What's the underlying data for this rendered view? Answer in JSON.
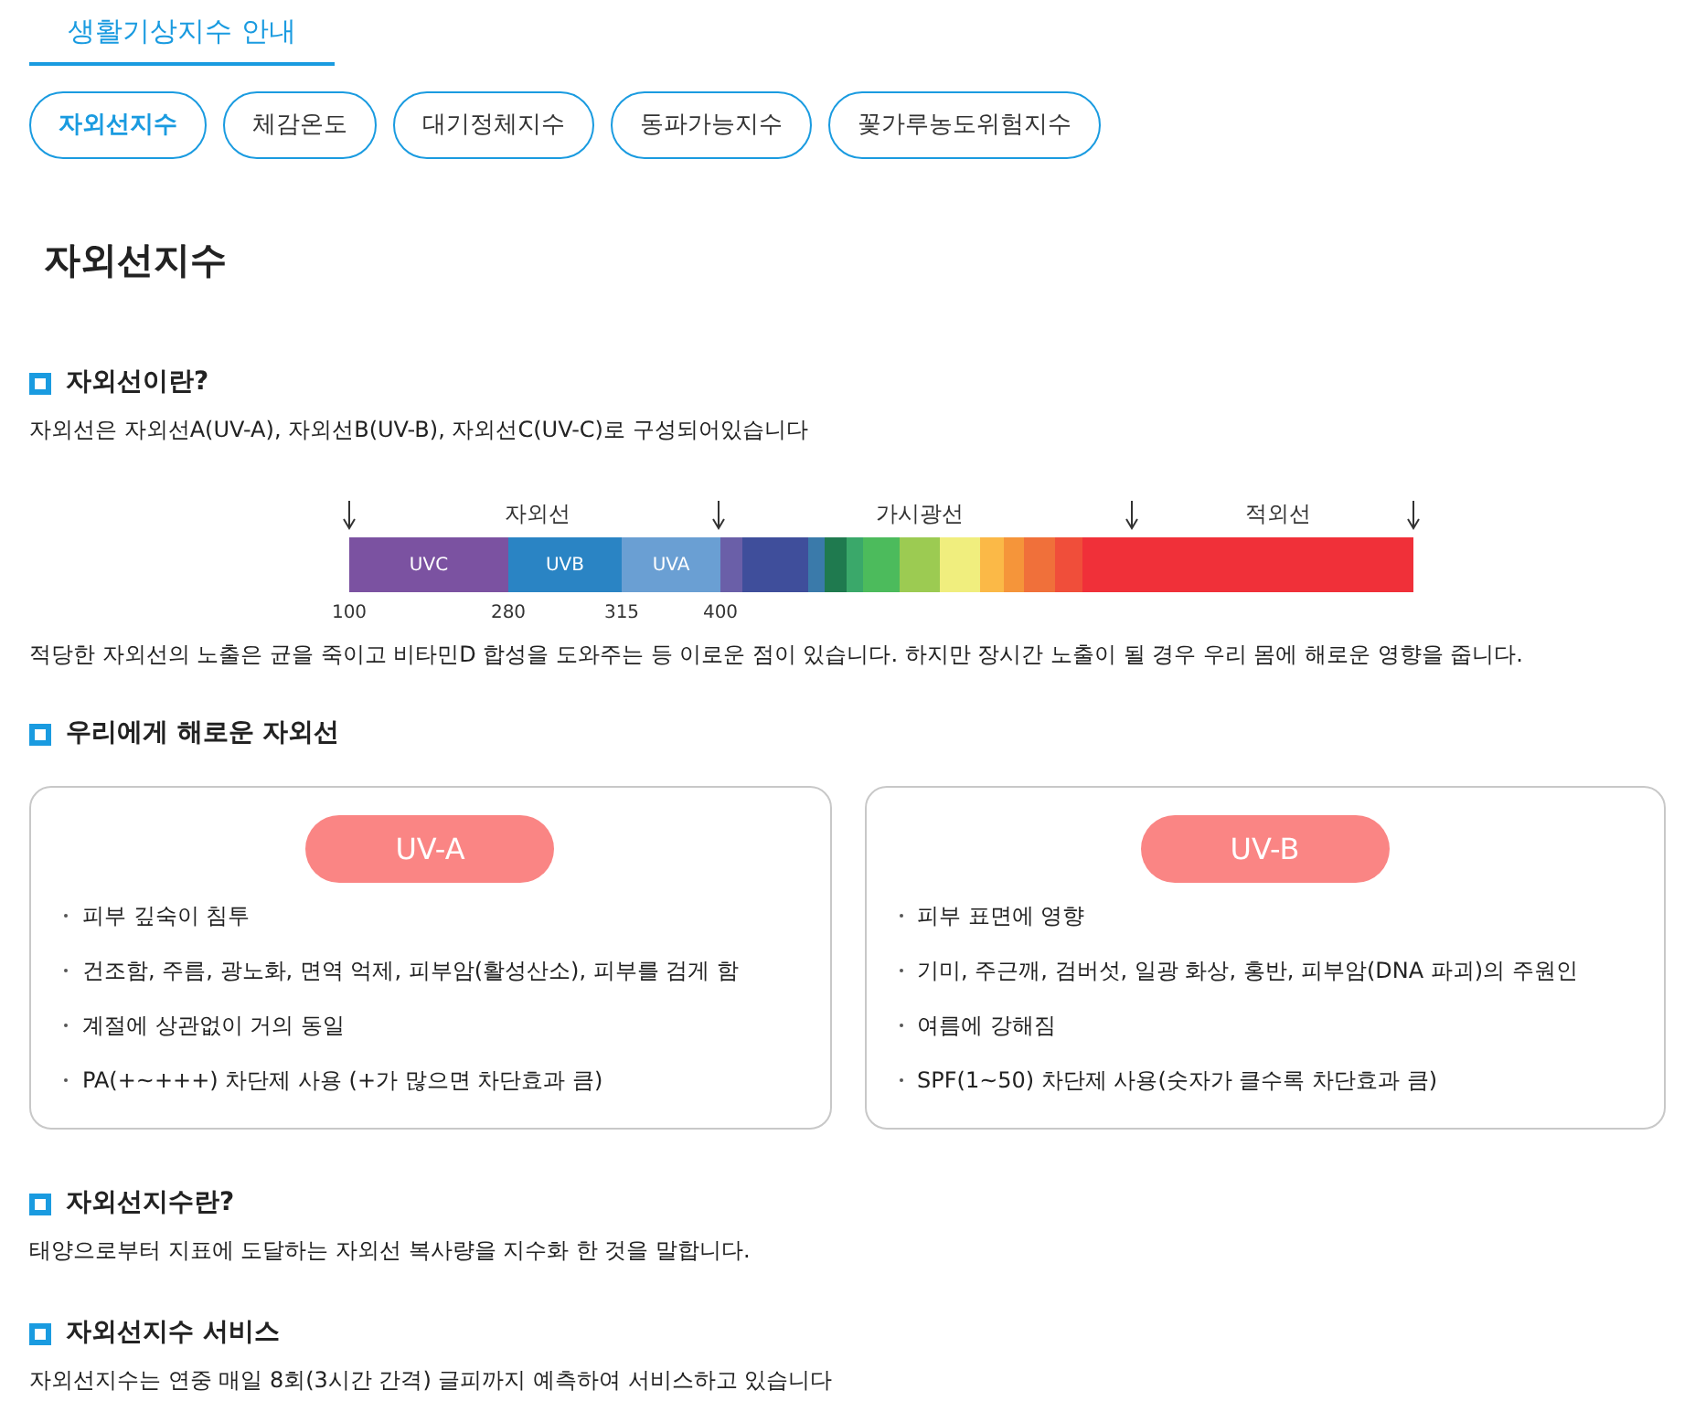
{
  "header_tab": {
    "label": "생활기상지수 안내",
    "selected": true
  },
  "index_tabs": [
    {
      "label": "자외선지수",
      "selected": true
    },
    {
      "label": "체감온도",
      "selected": false
    },
    {
      "label": "대기정체지수",
      "selected": false
    },
    {
      "label": "동파가능지수",
      "selected": false
    },
    {
      "label": "꽃가루농도위험지수",
      "selected": false
    }
  ],
  "page_title": "자외선지수",
  "section_1": {
    "heading": "자외선이란?",
    "text": "자외선은 자외선A(UV-A), 자외선B(UV-B), 자외선C(UV-C)로 구성되어있습니다",
    "spectrum": {
      "regions": [
        "자외선",
        "가시광선",
        "적외선"
      ],
      "ticks": [
        "100",
        "280",
        "315",
        "400"
      ],
      "segments": [
        {
          "label": "UVC",
          "color": "#7b52a1"
        },
        {
          "label": "UVB",
          "color": "#2a84c4"
        },
        {
          "label": "UVA",
          "color": "#6a9fd3"
        },
        {
          "color": "#6a5fa8"
        },
        {
          "color": "#3f4e9b"
        },
        {
          "color": "#3a7aaa"
        },
        {
          "color": "#1f7a4f"
        },
        {
          "color": "#3aa86a"
        },
        {
          "color": "#4cbb5c"
        },
        {
          "color": "#9ccb52"
        },
        {
          "color": "#f0ee7e"
        },
        {
          "color": "#fbb947"
        },
        {
          "color": "#f5953a"
        },
        {
          "color": "#f0703a"
        },
        {
          "color": "#f04e3a"
        },
        {
          "color": "#f03039"
        }
      ]
    },
    "note": "적당한 자외선의 노출은 균을 죽이고 비타민D 합성을 도와주는 등 이로운 점이 있습니다. 하지만 장시간 노출이 될 경우 우리 몸에 해로운 영향을 줍니다."
  },
  "section_2": {
    "heading": "우리에게 해로운 자외선",
    "cards": [
      {
        "badge": "UV-A",
        "items": [
          "피부 깊숙이 침투",
          "건조함, 주름, 광노화, 면역 억제, 피부암(활성산소), 피부를 검게 함",
          "계절에 상관없이 거의 동일",
          "PA(+~+++) 차단제 사용 (+가 많으면 차단효과 큼)"
        ]
      },
      {
        "badge": "UV-B",
        "items": [
          "피부 표면에 영향",
          "기미, 주근깨, 검버섯, 일광 화상, 홍반, 피부암(DNA 파괴)의 주원인",
          "여름에 강해짐",
          "SPF(1~50) 차단제 사용(숫자가 클수록 차단효과 큼)"
        ]
      }
    ]
  },
  "section_3": {
    "heading": "자외선지수란?",
    "text": "태양으로부터 지표에 도달하는 자외선 복사량을 지수화 한 것을 말합니다."
  },
  "section_4": {
    "heading": "자외선지수 서비스",
    "text": "자외선지수는 연중 매일 8회(3시간 간격) 글피까지 예측하여 서비스하고 있습니다"
  }
}
